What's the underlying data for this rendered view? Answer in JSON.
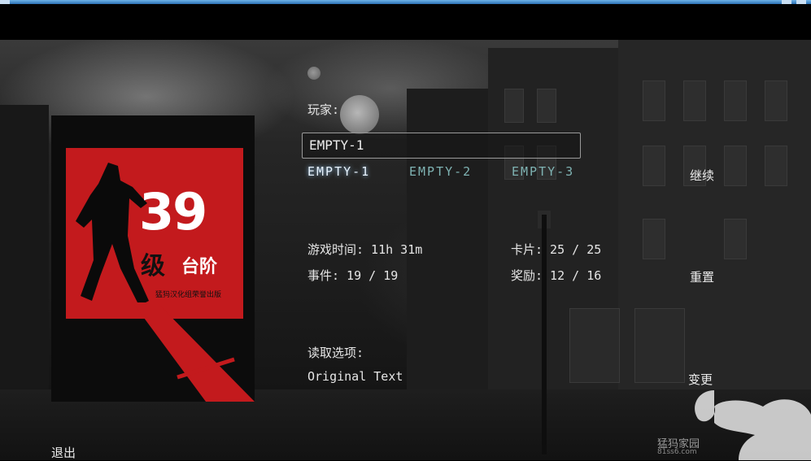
{
  "game": {
    "cover": {
      "number": "39",
      "title_part1": "级",
      "title_part2": "台阶",
      "publisher": "猛犸汉化组荣誉出版"
    },
    "player": {
      "label": "玩家:",
      "current_value": "EMPTY-1"
    },
    "slots": [
      {
        "label": "EMPTY-1",
        "active": true
      },
      {
        "label": "EMPTY-2",
        "active": false
      },
      {
        "label": "EMPTY-3",
        "active": false
      }
    ],
    "stats": {
      "playtime": "游戏时间: 11h 31m",
      "cards": "卡片: 25 / 25",
      "events": "事件: 19 / 19",
      "rewards": "奖励: 12 / 16"
    },
    "reading": {
      "label": "读取选项:",
      "value": "Original Text"
    },
    "buttons": {
      "continue": "继续",
      "reset": "重置",
      "change": "变更",
      "exit": "退出"
    },
    "watermark": {
      "site_name": "猛犸家园",
      "site_url": "81ss6.com"
    }
  }
}
